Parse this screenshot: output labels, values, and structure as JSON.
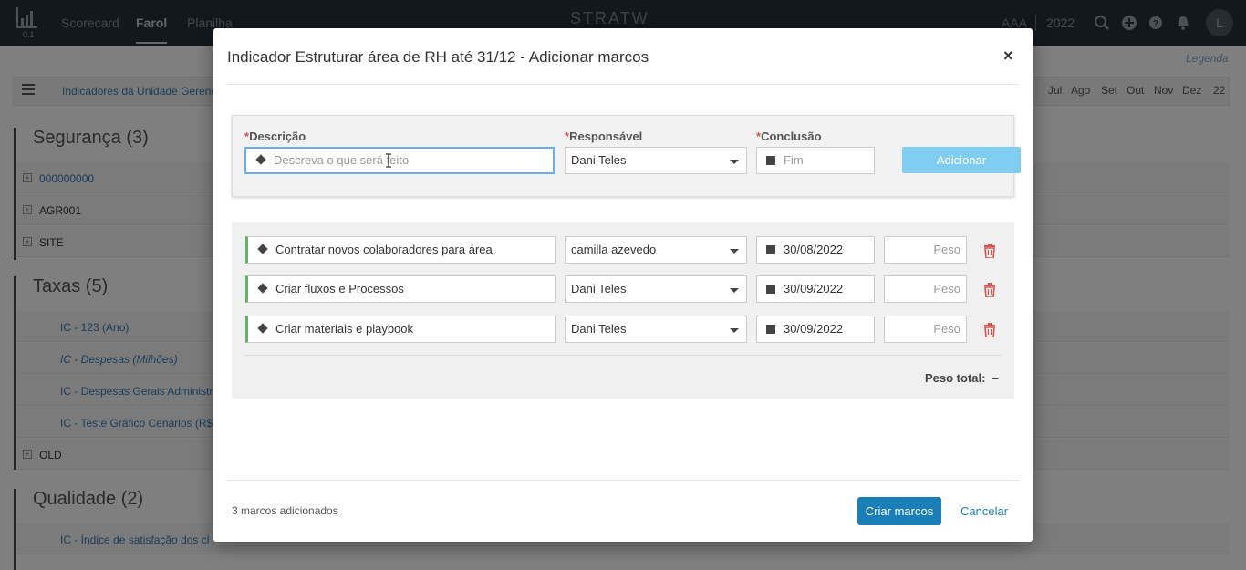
{
  "topbar": {
    "logo_version": "0.1",
    "nav": [
      "Scorecard",
      "Farol",
      "Planilha"
    ],
    "active_nav": "Farol",
    "brand": "STRATW",
    "org": "AAA",
    "year": "2022",
    "avatar_initial": "L"
  },
  "background": {
    "legenda": "Legenda",
    "breadcrumb": "Indicadores da Unidade Gerenc",
    "months": [
      "Jul",
      "Ago",
      "Set",
      "Out",
      "Nov",
      "Dez",
      "22"
    ],
    "sections": [
      {
        "title": "Segurança (3)",
        "rows": [
          "000000000",
          "AGR001",
          "SITE"
        ]
      },
      {
        "title": "Taxas (5)",
        "rows": [
          "IC - 123 (Ano)",
          "IC - Despesas (Milhões)",
          "IC - Despesas Gerais Administra",
          "IC - Teste Gráfico Cenários (R$)",
          "OLD"
        ]
      },
      {
        "title": "Qualidade (2)",
        "rows": [
          "IC - Índice de satisfação dos cl"
        ]
      }
    ]
  },
  "modal": {
    "title": "Indicador Estruturar área de RH até 31/12 - Adicionar marcos",
    "close": "×",
    "form": {
      "required_mark": "*",
      "descricao_label": "Descrição",
      "descricao_placeholder": "Descreva o que será feito",
      "responsavel_label": "Responsável",
      "responsavel_value": "Dani Teles",
      "conclusao_label": "Conclusão",
      "conclusao_placeholder": "Fim",
      "add_button": "Adicionar"
    },
    "milestones": [
      {
        "descricao": "Contratar novos colaboradores para área",
        "responsavel": "camilla azevedo",
        "data": "30/08/2022",
        "peso_placeholder": "Peso"
      },
      {
        "descricao": "Criar fluxos e Processos",
        "responsavel": "Dani Teles",
        "data": "30/09/2022",
        "peso_placeholder": "Peso"
      },
      {
        "descricao": "Criar materiais e playbook",
        "responsavel": "Dani Teles",
        "data": "30/09/2022",
        "peso_placeholder": "Peso"
      }
    ],
    "peso_total_label": "Peso total:",
    "peso_total_value": "–",
    "footer": {
      "count_text": "3 marcos adicionados",
      "create_button": "Criar marcos",
      "cancel_button": "Cancelar"
    }
  }
}
